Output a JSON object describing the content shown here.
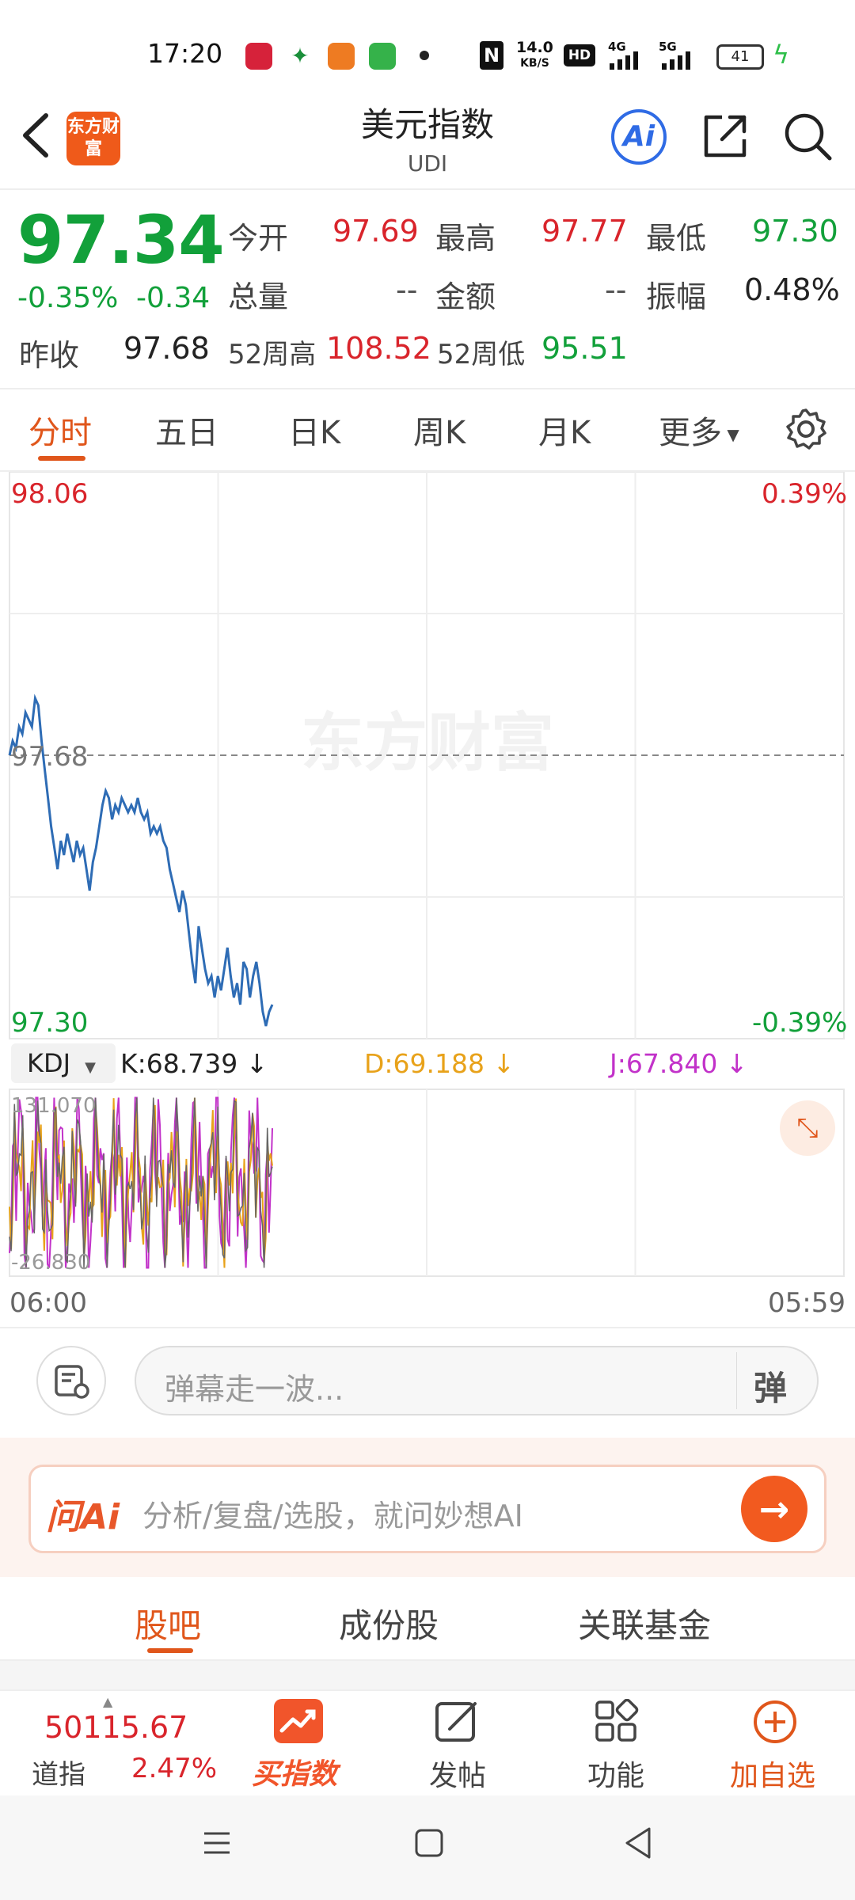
{
  "status_bar": {
    "time": "17:20",
    "net_speed": "14.0",
    "net_unit": "KB/S",
    "hd_badge": "HD",
    "net_4g": "4G",
    "net_5g": "5G",
    "battery": "41"
  },
  "header": {
    "back_icon": "chevron-left-icon",
    "logo_text": "东方财富",
    "title": "美元指数",
    "subtitle": "UDI",
    "ai_label": "Ai"
  },
  "quote": {
    "price": "97.34",
    "change_pct": "-0.35%",
    "change_abs": "-0.34",
    "prev_close_label": "昨收",
    "prev_close": "97.68",
    "open_label": "今开",
    "open": "97.69",
    "high_label": "最高",
    "high": "97.77",
    "low_label": "最低",
    "low": "97.30",
    "volume_label": "总量",
    "volume": "--",
    "amount_label": "金额",
    "amount": "--",
    "amplitude_label": "振幅",
    "amplitude": "0.48%",
    "week52_high_label": "52周高",
    "week52_high": "108.52",
    "week52_low_label": "52周低",
    "week52_low": "95.51"
  },
  "chart_tabs": [
    "分时",
    "五日",
    "日K",
    "周K",
    "月K",
    "更多"
  ],
  "chart": {
    "top_price": "98.06",
    "top_pct": "0.39%",
    "mid_price": "97.68",
    "bottom_price": "97.30",
    "bottom_pct": "-0.39%",
    "watermark": "东方财富",
    "kdj_selector": "KDJ",
    "kdj_k": "K:68.739",
    "kdj_d": "D:69.188",
    "kdj_j": "J:67.840",
    "kdj_top": "131.070",
    "kdj_bottom": "-26.830",
    "time_start": "06:00",
    "time_end": "05:59",
    "colors": {
      "price_line": "#2e6cb5",
      "k": "#666666",
      "d": "#e8a21a",
      "j": "#c232c9"
    }
  },
  "chart_data": {
    "type": "line",
    "title": "",
    "xlabel": "",
    "ylabel": "",
    "ylim": [
      97.3,
      98.06
    ],
    "x_range": [
      "06:00",
      "05:59"
    ],
    "reference_line": 97.68,
    "series": [
      {
        "values": [
          97.68,
          97.7,
          97.69,
          97.72,
          97.71,
          97.74,
          97.73,
          97.72,
          97.76,
          97.75,
          97.7,
          97.66,
          97.62,
          97.58,
          97.55,
          97.52,
          97.56,
          97.54,
          97.57,
          97.55,
          97.53,
          97.56,
          97.54,
          97.55,
          97.52,
          97.49,
          97.53,
          97.55,
          97.58,
          97.61,
          97.63,
          97.62,
          97.59,
          97.61,
          97.6,
          97.62,
          97.61,
          97.6,
          97.61,
          97.6,
          97.62,
          97.6,
          97.59,
          97.6,
          97.57,
          97.58,
          97.57,
          97.58,
          97.56,
          97.55,
          97.52,
          97.5,
          97.48,
          97.46,
          97.49,
          97.47,
          97.43,
          97.39,
          97.36,
          97.44,
          97.41,
          97.38,
          97.36,
          97.37,
          97.34,
          97.37,
          97.35,
          97.38,
          97.41,
          97.37,
          97.34,
          97.36,
          97.33,
          97.39,
          97.38,
          97.34,
          97.37,
          97.39,
          97.36,
          97.32,
          97.3,
          97.32,
          97.33
        ]
      }
    ]
  },
  "danmaku": {
    "placeholder": "弹幕走一波...",
    "send_label": "弹"
  },
  "ai_bar": {
    "logo": "问Ai",
    "placeholder": "分析/复盘/选股，就问妙想AI"
  },
  "bottom_tabs": [
    "股吧",
    "成份股",
    "关联基金"
  ],
  "toolbar": {
    "dji_value": "50115.67",
    "dji_name": "道指",
    "dji_pct": "2.47%",
    "buy_label": "买指数",
    "post_label": "发帖",
    "func_label": "功能",
    "add_label": "加自选"
  }
}
